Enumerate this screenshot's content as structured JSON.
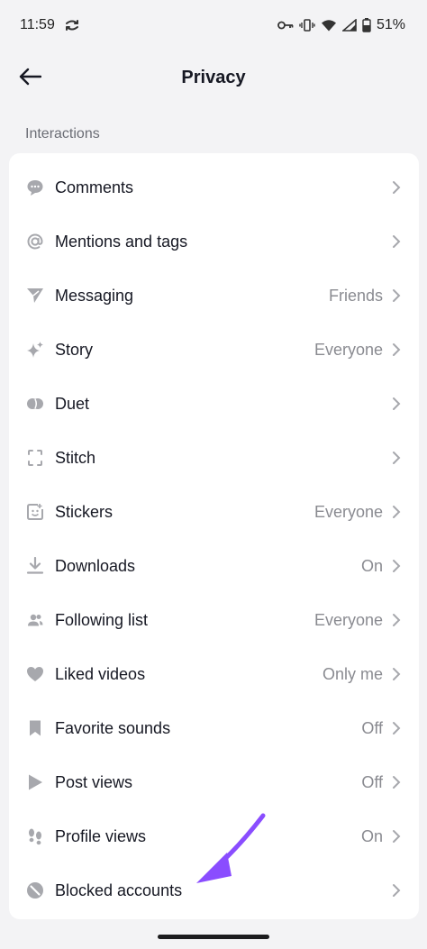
{
  "status_bar": {
    "time": "11:59",
    "battery": "51%"
  },
  "header": {
    "title": "Privacy"
  },
  "section": {
    "label": "Interactions"
  },
  "rows": [
    {
      "label": "Comments",
      "value": "",
      "icon": "comment-icon"
    },
    {
      "label": "Mentions and tags",
      "value": "",
      "icon": "at-icon"
    },
    {
      "label": "Messaging",
      "value": "Friends",
      "icon": "send-icon"
    },
    {
      "label": "Story",
      "value": "Everyone",
      "icon": "sparkle-icon"
    },
    {
      "label": "Duet",
      "value": "",
      "icon": "duet-icon"
    },
    {
      "label": "Stitch",
      "value": "",
      "icon": "stitch-icon"
    },
    {
      "label": "Stickers",
      "value": "Everyone",
      "icon": "sticker-icon"
    },
    {
      "label": "Downloads",
      "value": "On",
      "icon": "download-icon"
    },
    {
      "label": "Following list",
      "value": "Everyone",
      "icon": "people-icon"
    },
    {
      "label": "Liked videos",
      "value": "Only me",
      "icon": "heart-icon"
    },
    {
      "label": "Favorite sounds",
      "value": "Off",
      "icon": "bookmark-icon"
    },
    {
      "label": "Post views",
      "value": "Off",
      "icon": "play-icon"
    },
    {
      "label": "Profile views",
      "value": "On",
      "icon": "footprints-icon"
    },
    {
      "label": "Blocked accounts",
      "value": "",
      "icon": "blocked-icon"
    }
  ],
  "colors": {
    "background": "#f3f3f5",
    "card": "#ffffff",
    "icon_gray": "#a7a8ad",
    "value_gray": "#8a8b91",
    "annotation_arrow": "#8a4dff"
  }
}
